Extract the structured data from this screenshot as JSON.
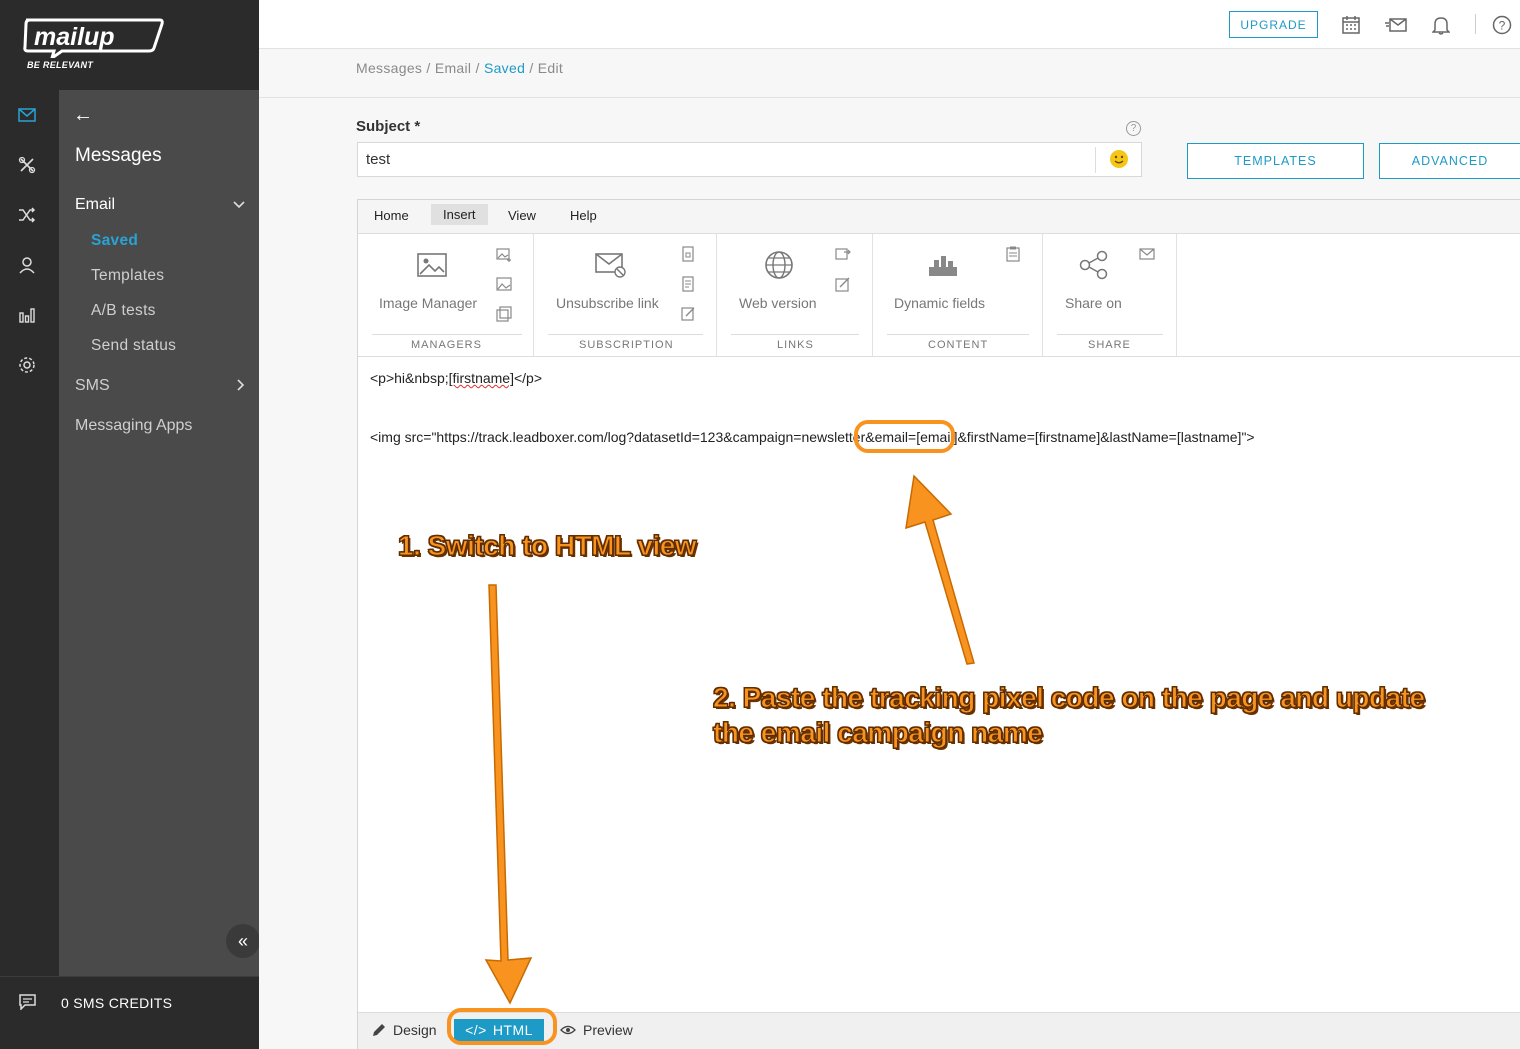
{
  "brand": {
    "logo": "mailup",
    "tagline": "BE RELEVANT"
  },
  "rail": {
    "icons": [
      "mail-icon",
      "tools-icon",
      "shuffle-icon",
      "user-icon",
      "bar-chart-icon",
      "gear-icon"
    ]
  },
  "subnav": {
    "title": "Messages",
    "email_group": "Email",
    "email_items": [
      "Saved",
      "Templates",
      "A/B tests",
      "Send status"
    ],
    "sms": "SMS",
    "messaging_apps": "Messaging Apps"
  },
  "credits": "0 SMS CREDITS",
  "topbar": {
    "upgrade": "UPGRADE"
  },
  "breadcrumb": {
    "messages": "Messages",
    "email": "Email",
    "saved": "Saved",
    "edit": "Edit",
    "sep": "/"
  },
  "subject": {
    "label": "Subject *",
    "value": "test",
    "help": "?"
  },
  "buttons": {
    "templates": "TEMPLATES",
    "advanced": "ADVANCED"
  },
  "editor": {
    "menu": [
      "Home",
      "Insert",
      "View",
      "Help"
    ],
    "ribbon": {
      "managers": {
        "label": "Image Manager",
        "group": "MANAGERS"
      },
      "subscription": {
        "label": "Unsubscribe link",
        "group": "SUBSCRIPTION"
      },
      "links": {
        "label": "Web version",
        "group": "LINKS"
      },
      "content": {
        "label": "Dynamic fields",
        "group": "CONTENT"
      },
      "share": {
        "label": "Share on",
        "group": "SHARE"
      }
    },
    "code": {
      "line1_a": "<p>hi&nbsp;",
      "line1_b": "[firstname]",
      "line1_c": "</p>",
      "line2": "<img src=\"https://track.leadboxer.com/log?datasetId=123&campaign=newsletter&email=[email]&firstName=[firstname]&lastName=[lastname]\">"
    },
    "bottom": {
      "design": "Design",
      "html": "HTML",
      "preview": "Preview"
    }
  },
  "annotations": {
    "step1": "1. Switch to HTML view",
    "step2_line1": "2. Paste the tracking pixel code on the page and update",
    "step2_line2": "the email campaign name"
  },
  "colors": {
    "accent": "#1d9bc6",
    "annotation": "#f7931e",
    "sidebar": "#2b2b2b",
    "subnav": "#4a4a4a"
  }
}
